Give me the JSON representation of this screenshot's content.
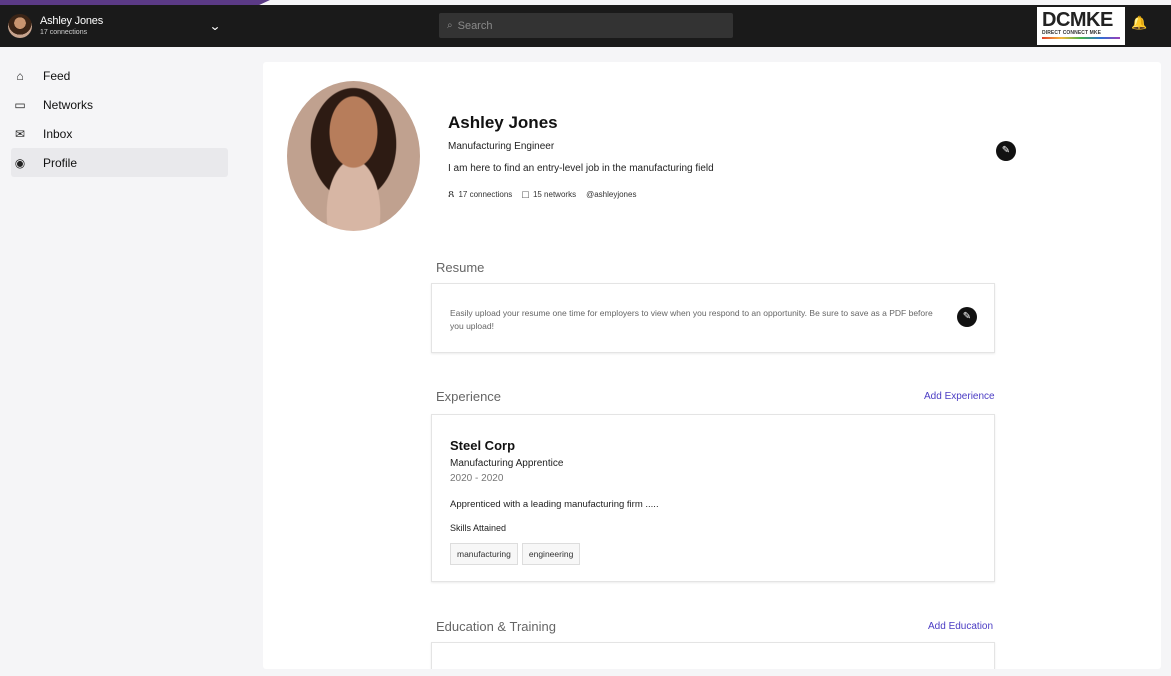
{
  "header": {
    "user_name": "Ashley Jones",
    "user_subtitle": "17 connections",
    "search_placeholder": "Search",
    "logo_text": "DCMKE",
    "logo_subtext": "DIRECT CONNECT MKE",
    "chevron_icon": "chevron-down-icon",
    "bell_icon": "bell-icon"
  },
  "sidebar": {
    "items": [
      {
        "label": "Feed",
        "icon": "home-icon"
      },
      {
        "label": "Networks",
        "icon": "network-icon"
      },
      {
        "label": "Inbox",
        "icon": "mail-icon"
      },
      {
        "label": "Profile",
        "icon": "user-icon",
        "active": true
      }
    ]
  },
  "profile": {
    "name": "Ashley Jones",
    "title": "Manufacturing Engineer",
    "bio": "I am here to find an entry-level job in the manufacturing field",
    "connections": "17 connections",
    "networks": "15 networks",
    "handle": "@ashleyjones"
  },
  "resume": {
    "heading": "Resume",
    "text": "Easily upload your resume one time for employers to view when you respond to an opportunity. Be sure to save as a PDF before you upload!"
  },
  "experience": {
    "heading": "Experience",
    "add_label": "Add Experience",
    "items": [
      {
        "company": "Steel Corp",
        "role": "Manufacturing Apprentice",
        "dates": "2020 - 2020",
        "description": "Apprenticed with a leading manufacturing firm .....",
        "skills_label": "Skills Attained",
        "skills": [
          "manufacturing",
          "engineering"
        ]
      }
    ]
  },
  "education": {
    "heading": "Education & Training",
    "add_label": "Add Education"
  },
  "colors": {
    "accent": "#4b3cc4",
    "topbar": "#1a1a1a",
    "top_accent": "#5b3a86"
  }
}
